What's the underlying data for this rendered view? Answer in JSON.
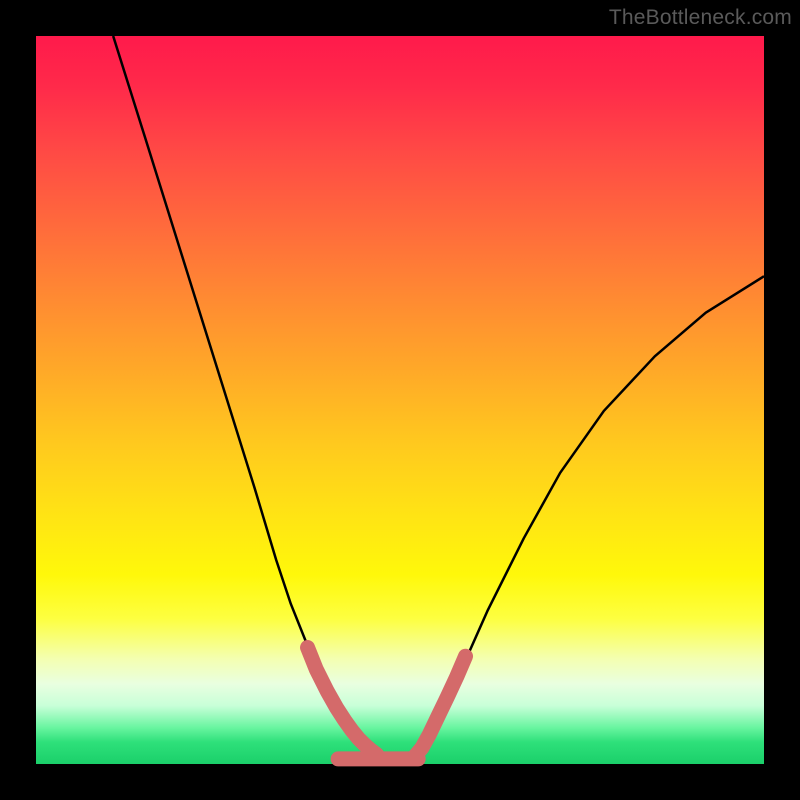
{
  "watermark": {
    "text": "TheBottleneck.com"
  },
  "chart_data": {
    "type": "line",
    "title": "",
    "xlabel": "",
    "ylabel": "",
    "xlim": [
      0,
      100
    ],
    "ylim": [
      0,
      100
    ],
    "grid": false,
    "legend": false,
    "series": [
      {
        "name": "left-curve",
        "stroke": "#000000",
        "stroke_width": 2.5,
        "x": [
          10.6,
          15.0,
          20.0,
          25.0,
          30.0,
          33.0,
          35.0,
          37.0,
          39.0,
          41.0,
          42.5,
          44.0,
          46.0
        ],
        "values": [
          100.0,
          86.0,
          70.0,
          54.0,
          38.0,
          28.0,
          22.0,
          17.0,
          12.0,
          7.5,
          5.0,
          3.0,
          1.2
        ]
      },
      {
        "name": "right-curve",
        "stroke": "#000000",
        "stroke_width": 2.5,
        "x": [
          52.8,
          55.0,
          58.0,
          62.0,
          67.0,
          72.0,
          78.0,
          85.0,
          92.0,
          100.0
        ],
        "values": [
          1.2,
          5.0,
          12.0,
          21.0,
          31.0,
          40.0,
          48.5,
          56.0,
          62.0,
          67.0
        ]
      },
      {
        "name": "left-marker-band",
        "stroke": "#d46a6a",
        "stroke_width": 15,
        "linecap": "round",
        "x": [
          37.3,
          38.5,
          40.0,
          41.3,
          42.4,
          43.4,
          44.3,
          45.2,
          46.0,
          46.8
        ],
        "values": [
          16.0,
          13.0,
          10.0,
          7.7,
          6.0,
          4.6,
          3.5,
          2.6,
          1.9,
          1.3
        ]
      },
      {
        "name": "bottom-band",
        "stroke": "#d46a6a",
        "stroke_width": 15,
        "linecap": "round",
        "x": [
          41.5,
          44.0,
          47.0,
          50.0,
          52.5
        ],
        "values": [
          0.7,
          0.7,
          0.7,
          0.7,
          0.7
        ]
      },
      {
        "name": "right-marker-band",
        "stroke": "#d46a6a",
        "stroke_width": 15,
        "linecap": "round",
        "x": [
          52.0,
          53.0,
          54.0,
          55.2,
          56.5,
          57.8,
          59.0
        ],
        "values": [
          1.0,
          2.2,
          4.0,
          6.5,
          9.2,
          12.0,
          14.8
        ]
      }
    ]
  }
}
